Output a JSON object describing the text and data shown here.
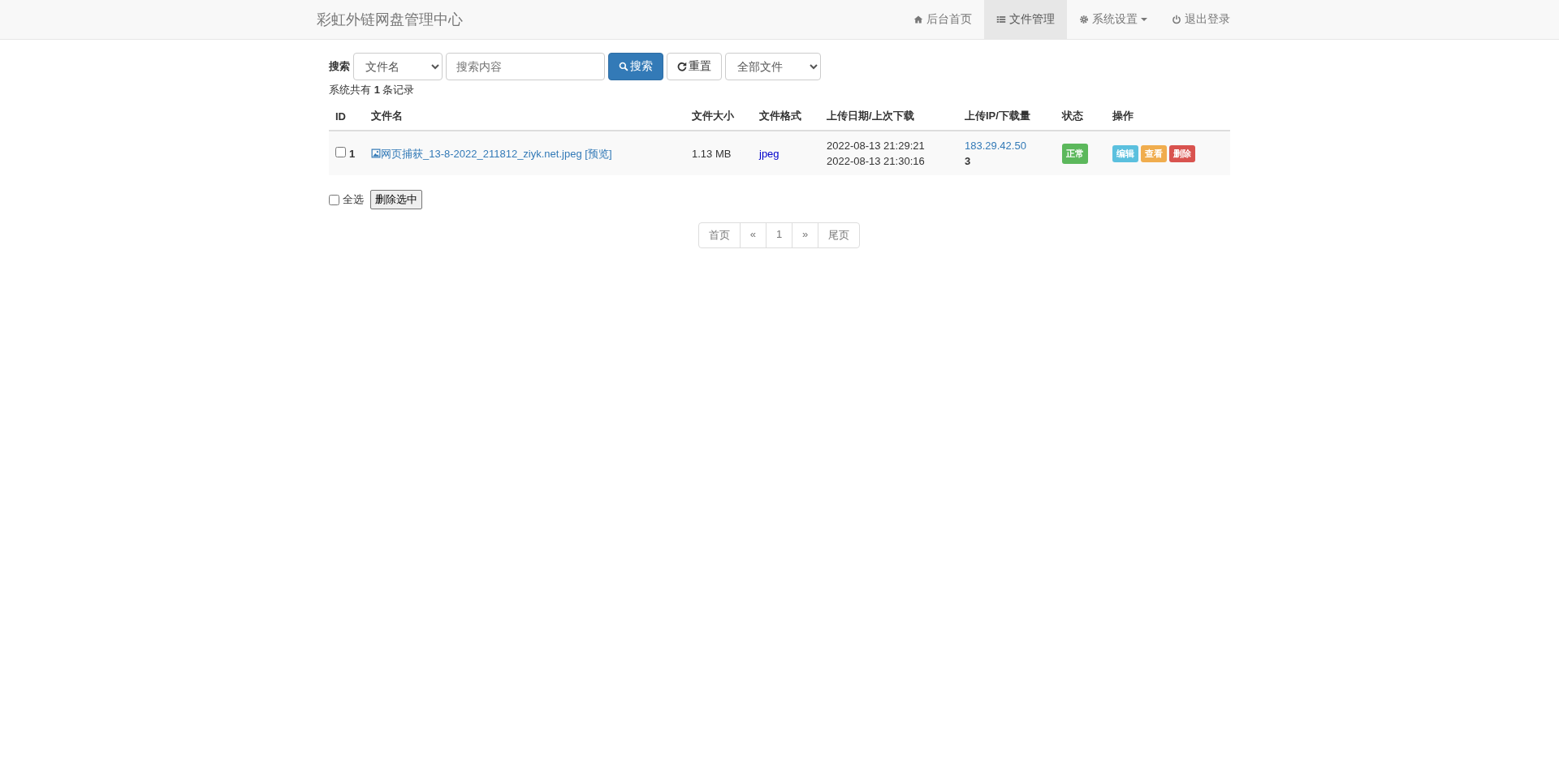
{
  "navbar": {
    "brand": "彩虹外链网盘管理中心",
    "items": [
      {
        "label": "后台首页",
        "kind": "link",
        "selected": false
      },
      {
        "label": "文件管理",
        "kind": "link",
        "selected": true
      },
      {
        "label": "系统设置",
        "kind": "dropdown",
        "selected": false
      },
      {
        "label": "退出登录",
        "kind": "link",
        "selected": false
      }
    ]
  },
  "search": {
    "label": "搜索",
    "field_select": "文件名",
    "placeholder": "搜索内容",
    "search_button": "搜索",
    "reset_button": "重置",
    "type_select": "全部文件"
  },
  "summary": "系统共有 **1** 条记录",
  "table": {
    "columns": [
      "ID",
      "文件名",
      "文件大小",
      "文件格式",
      "上传日期/上次下载",
      "上传IP/下载量",
      "状态",
      "操作"
    ],
    "rows": [
      {
        "checked": false,
        "id": "1",
        "file_name": "网页捕获_13-8-2022_211812_ziyk.net.jpeg",
        "preview": "[预览]",
        "size": "1.13 MB",
        "format": "jpeg",
        "uploaded": "2022-08-13 21:29:21",
        "last_download": "2022-08-13 21:30:16",
        "ip": "183.29.42.50",
        "downloads": "3",
        "status": {
          "label": "正常",
          "kind": "success"
        },
        "actions": [
          {
            "label": "编辑",
            "kind": "info"
          },
          {
            "label": "查看",
            "kind": "warning"
          },
          {
            "label": "删除",
            "kind": "danger"
          }
        ]
      }
    ]
  },
  "select_all": {
    "label": "全选",
    "checked": false
  },
  "delete_selected": "删除选中",
  "pagination": [
    "首页",
    "«",
    "1",
    "»",
    "尾页"
  ]
}
